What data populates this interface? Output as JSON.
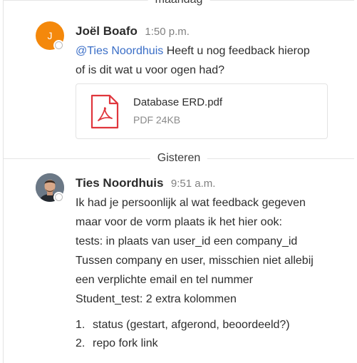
{
  "separators": {
    "day1": "maandag",
    "day2": "Gisteren"
  },
  "messages": [
    {
      "author": "Joël Boafo",
      "time": "1:50 p.m.",
      "avatar_initial": "J",
      "mention": "@Ties Noordhuis",
      "lines": [
        "Heeft u nog feedback hierop",
        "of is dit wat u voor ogen had?"
      ],
      "attachment": {
        "name": "Database ERD.pdf",
        "meta": "PDF 24KB",
        "icon": "pdf-file-icon"
      }
    },
    {
      "author": "Ties Noordhuis",
      "time": "9:51 a.m.",
      "lines": [
        "Ik had je persoonlijk al wat feedback gegeven",
        "maar voor de vorm plaats ik het hier ook:",
        "tests: in plaats van user_id een company_id",
        "Tussen company en user, misschien niet allebij",
        "een verplichte email en tel nummer",
        "Student_test: 2 extra kolommen"
      ],
      "list": [
        {
          "num": "1.",
          "text": "status (gestart, afgerond, beoordeeld?)"
        },
        {
          "num": "2.",
          "text": "repo fork link"
        }
      ]
    }
  ],
  "colors": {
    "mention": "#3a6ec7",
    "avatar_j": "#f4880b",
    "pdf_red": "#e0363d",
    "presence": "#b9b9b9"
  }
}
